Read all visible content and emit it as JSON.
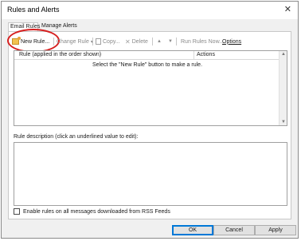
{
  "window": {
    "title": "Rules and Alerts"
  },
  "tabs": [
    {
      "label": "Email Rules",
      "selected": true
    },
    {
      "label": "Manage Alerts",
      "selected": false
    }
  ],
  "toolbar": {
    "new_rule": "New Rule...",
    "change_rule": "Change Rule",
    "copy": "Copy...",
    "delete": "Delete",
    "move_up": "▲",
    "move_down": "▼",
    "run_rules": "Run Rules Now...",
    "options": "Options"
  },
  "rules_list": {
    "columns": [
      "Rule (applied in the order shown)",
      "Actions"
    ],
    "empty_message": "Select the \"New Rule\" button to make a rule."
  },
  "description": {
    "label": "Rule description (click an underlined value to edit):"
  },
  "rss": {
    "label": "Enable rules on all messages downloaded from RSS Feeds",
    "checked": false
  },
  "buttons": {
    "ok": "OK",
    "cancel": "Cancel",
    "apply": "Apply"
  },
  "colors": {
    "highlight_circle": "#d61f1f",
    "default_button_border": "#0078d7"
  }
}
